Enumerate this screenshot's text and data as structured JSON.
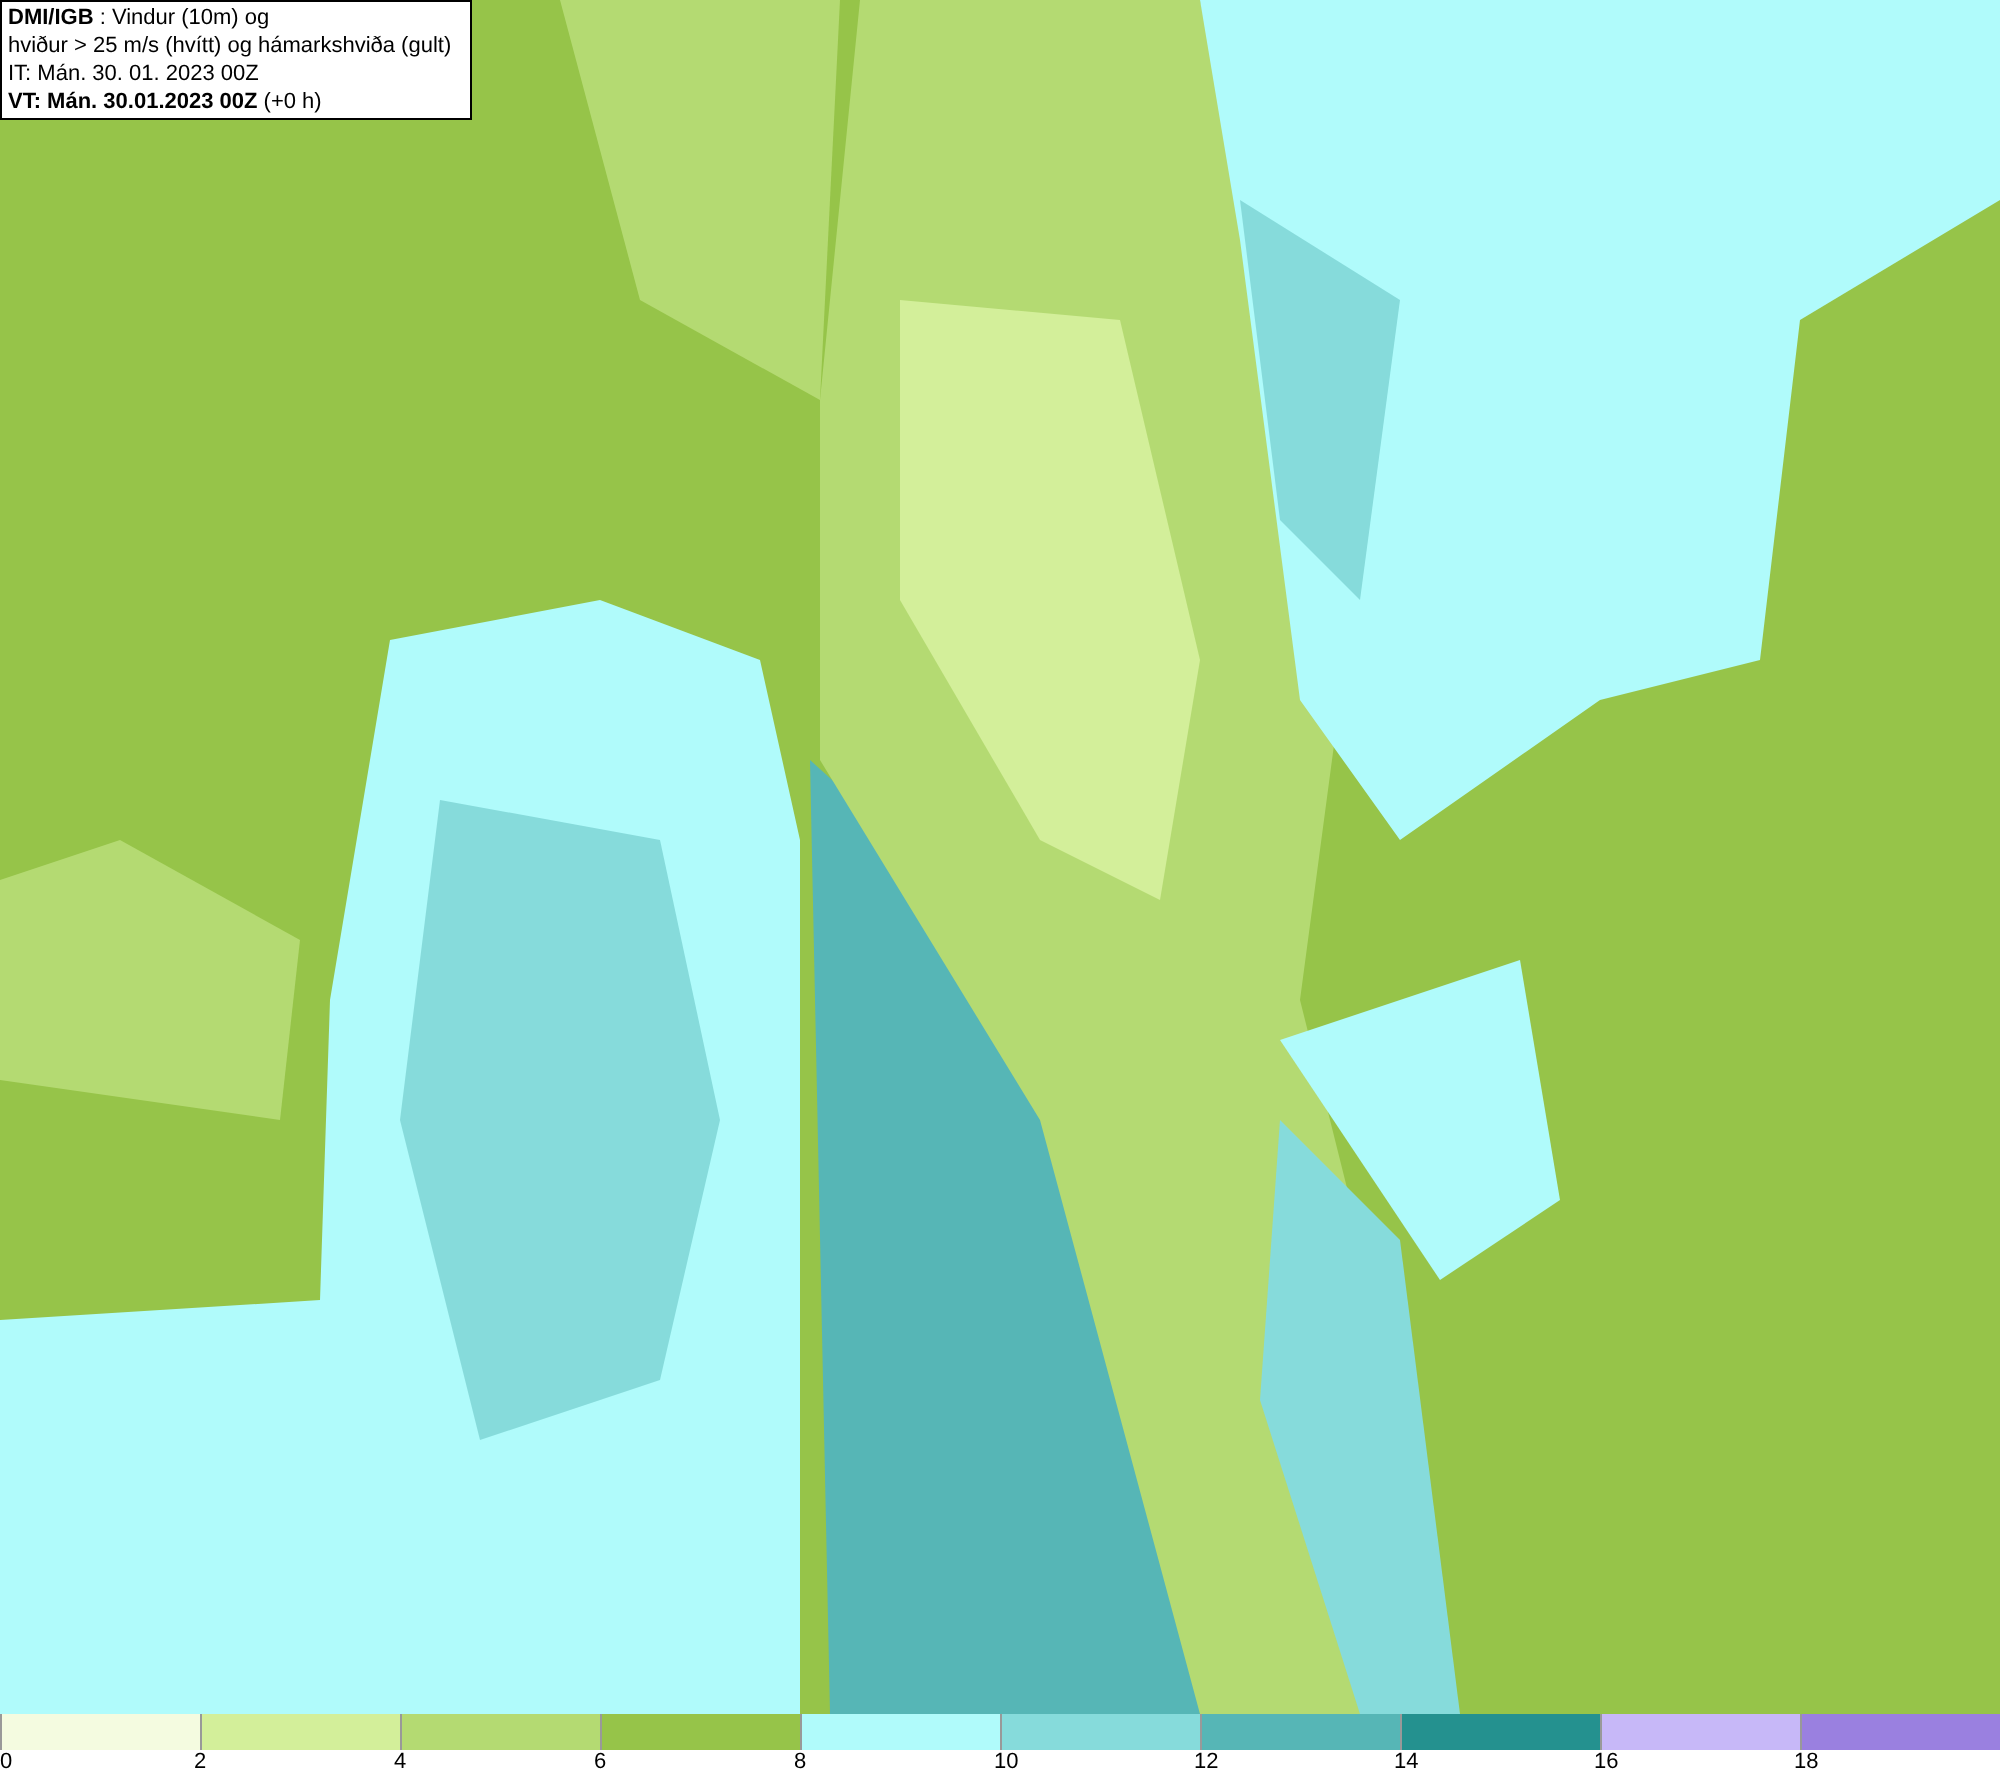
{
  "info_box": {
    "lines": [
      "**DMI/IGB** : Vindur (10m) og",
      "hviður > 25 m/s (hvítt) og hámarkshviða (gult)",
      "IT: Mán. 30. 01. 2023 00Z",
      "**VT: Mán. 30.01.2023 00Z** (+0 h)"
    ]
  },
  "legend": [
    {
      "label": "0",
      "color": "#f4fbe0"
    },
    {
      "label": "2",
      "color": "#d3ef9a"
    },
    {
      "label": "4",
      "color": "#b4da72"
    },
    {
      "label": "6",
      "color": "#96c449"
    },
    {
      "label": "8",
      "color": "#b0fbfb"
    },
    {
      "label": "10",
      "color": "#86dbdb"
    },
    {
      "label": "12",
      "color": "#56b6b6"
    },
    {
      "label": "14",
      "color": "#24918f"
    },
    {
      "label": "16",
      "color": "#c7b8f8"
    },
    {
      "label": "18",
      "color": "#9a80e0"
    }
  ]
}
